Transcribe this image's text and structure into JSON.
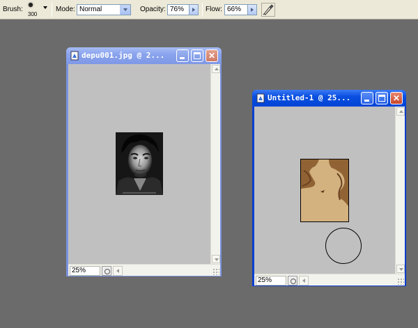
{
  "options_bar": {
    "brush_label": "Brush:",
    "brush_size": "300",
    "mode_label": "Mode:",
    "mode_value": "Normal",
    "opacity_label": "Opacity:",
    "opacity_value": "76%",
    "flow_label": "Flow:",
    "flow_value": "66%",
    "airbrush_icon": "airbrush-icon"
  },
  "windows": [
    {
      "title": "depu001.jpg @ 2...",
      "state": "inactive",
      "zoom": "25%",
      "icon": "document-icon"
    },
    {
      "title": "Untitled-1 @ 25...",
      "state": "active",
      "zoom": "25%",
      "icon": "document-icon"
    }
  ],
  "colors": {
    "workspace": "#6b6b6b",
    "canvas_bg": "#c0c0c0",
    "untitled_fill": "#d3b27f",
    "untitled_stroke": "#7a4a22",
    "active_title": "#0a4fe0",
    "inactive_title": "#8aa4ee"
  }
}
